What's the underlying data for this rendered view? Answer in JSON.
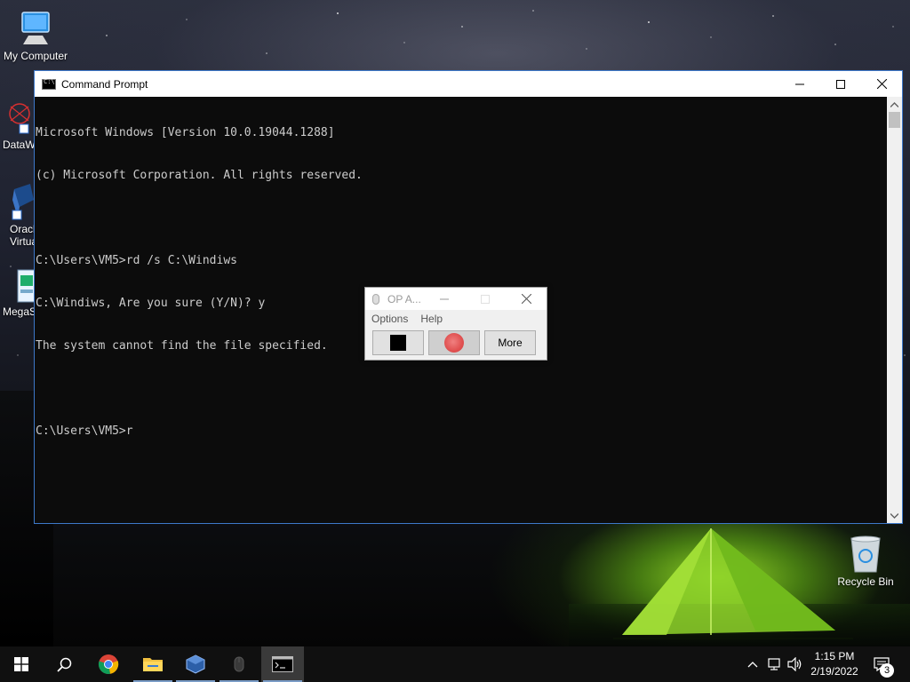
{
  "desktop": {
    "icons": [
      {
        "label": "My Computer"
      },
      {
        "label": "DataWC"
      },
      {
        "label": "Oracl\nVirtua"
      },
      {
        "label": "MegaS"
      },
      {
        "label": "Recycle Bin"
      }
    ]
  },
  "cmd": {
    "title": "Command Prompt",
    "lines": [
      "Microsoft Windows [Version 10.0.19044.1288]",
      "(c) Microsoft Corporation. All rights reserved.",
      "",
      "C:\\Users\\VM5>rd /s C:\\Windiws",
      "C:\\Windiws, Are you sure (Y/N)? y",
      "The system cannot find the file specified.",
      "",
      "C:\\Users\\VM5>r"
    ]
  },
  "op_window": {
    "title": "OP A...",
    "menu": [
      "Options",
      "Help"
    ],
    "more_label": "More"
  },
  "taskbar": {
    "time": "1:15 PM",
    "date": "2/19/2022",
    "notification_count": "3",
    "accent": "#7a9cc6"
  },
  "colors": {
    "cmd_text": "#cccccc",
    "cmd_bg": "#0c0c0c",
    "window_border": "#3d78c9"
  }
}
